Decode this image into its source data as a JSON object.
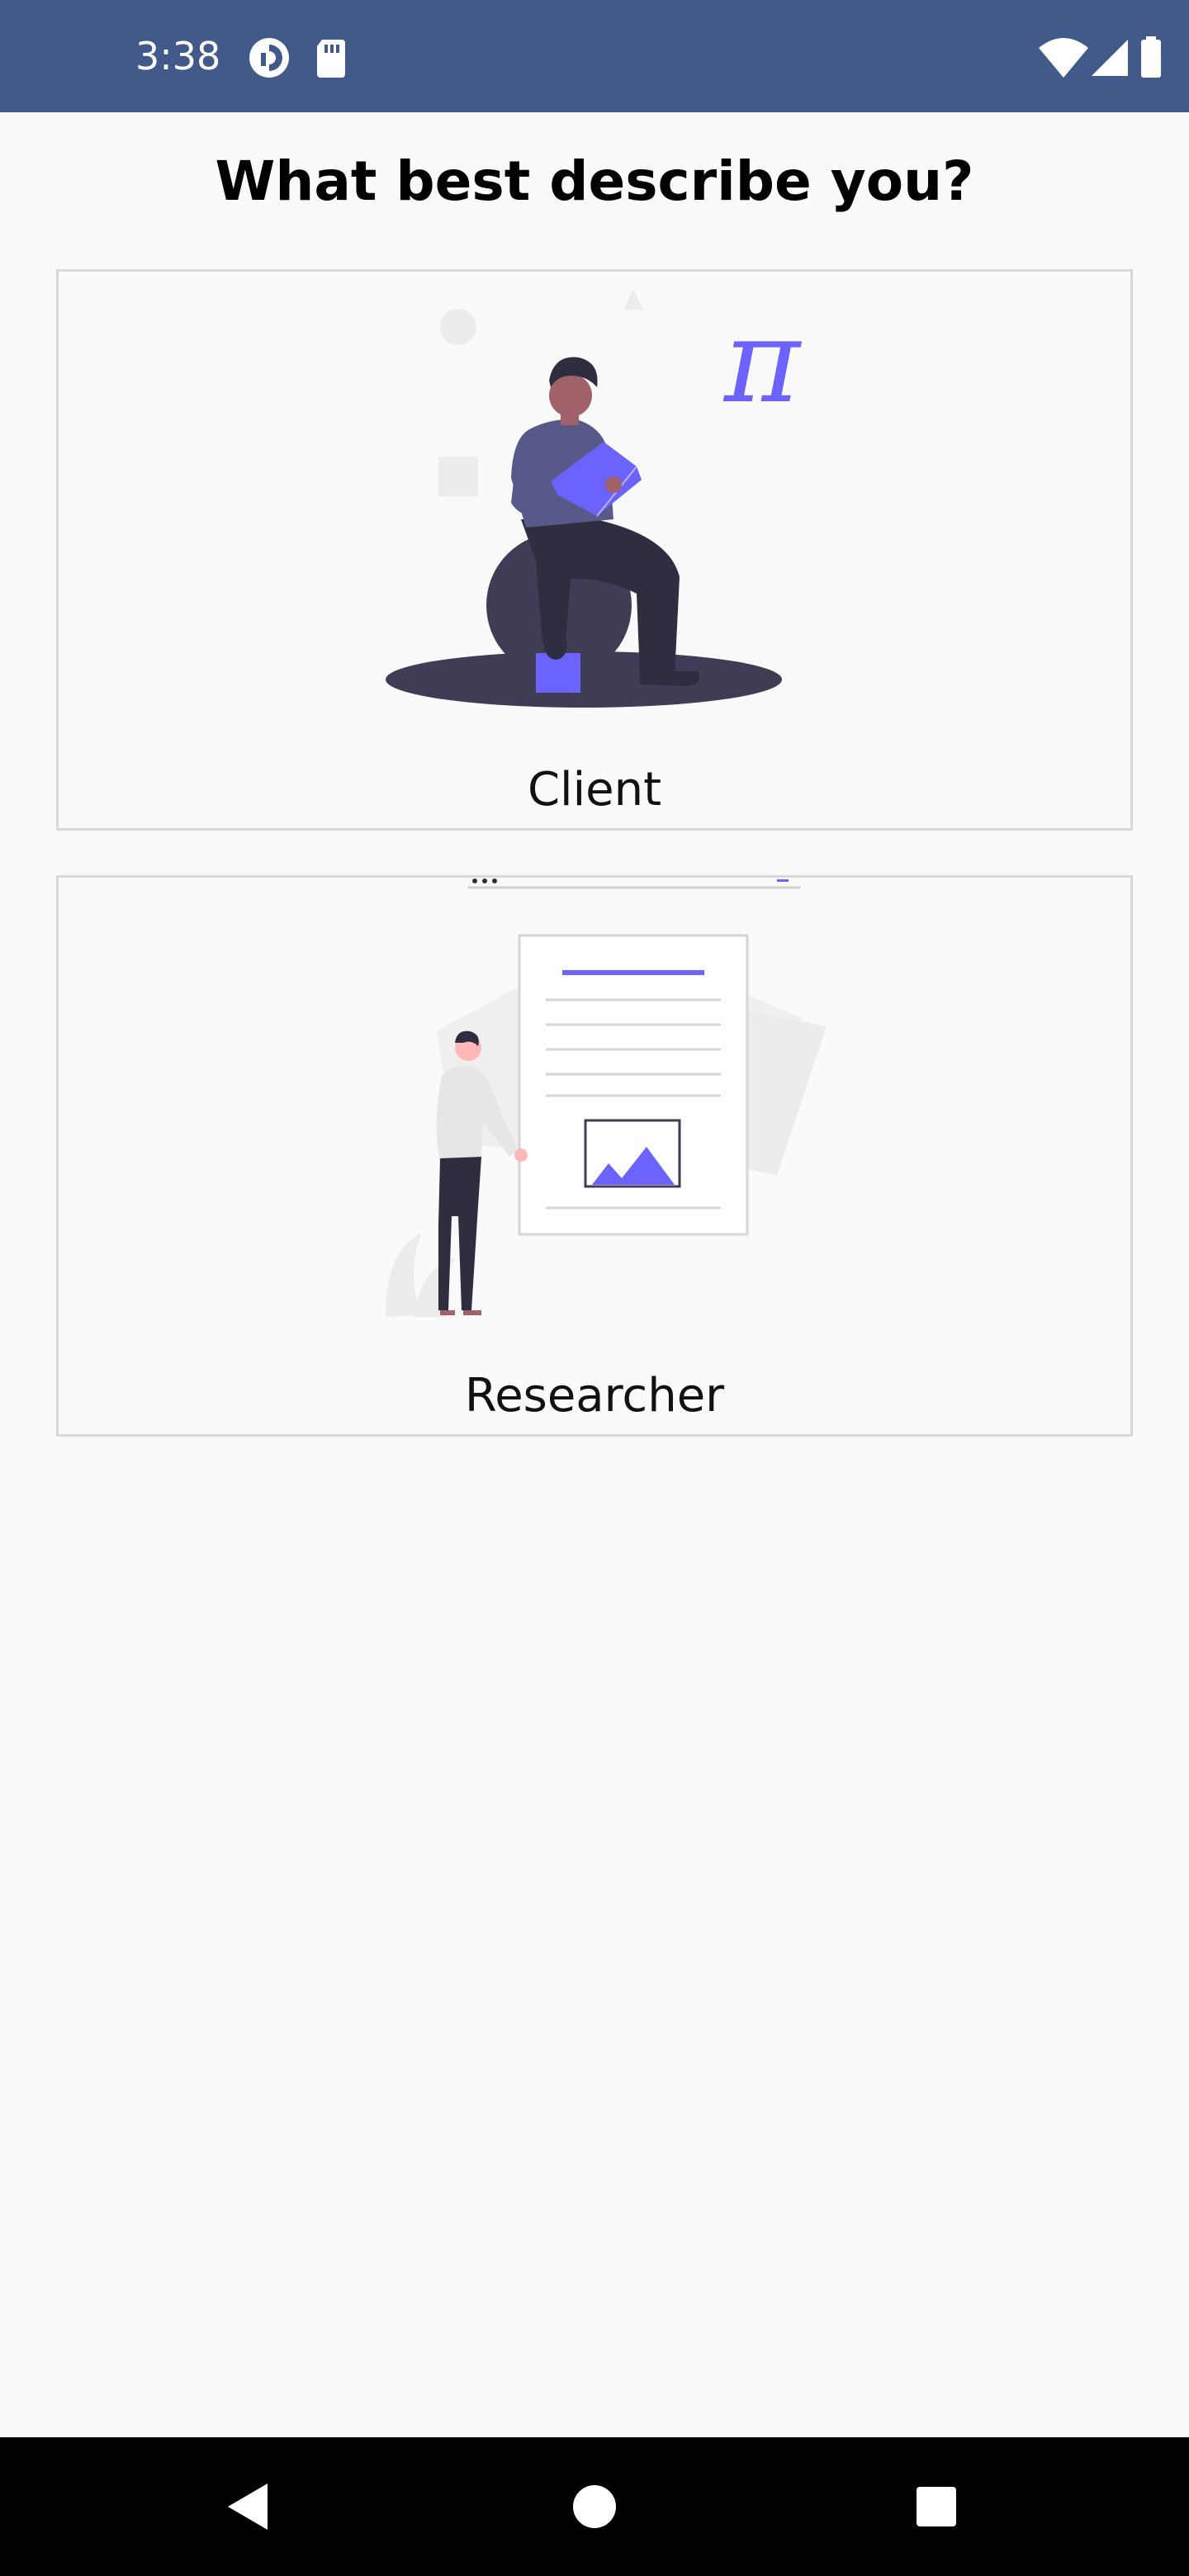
{
  "status_bar": {
    "time": "3:38",
    "background": "#425a8a",
    "icons": [
      "pocket-casts-icon",
      "sd-card-icon",
      "wifi-icon",
      "cell-signal-icon",
      "battery-icon"
    ]
  },
  "page": {
    "title": "What best describe you?"
  },
  "options": [
    {
      "label": "Client",
      "illustration": "person-reading-book-illustration"
    },
    {
      "label": "Researcher",
      "illustration": "person-presenting-document-illustration"
    }
  ],
  "colors": {
    "accent": "#6c63ff",
    "dark_figure": "#2f2e41",
    "card_border": "#d9d9d9",
    "background": "#fafafa"
  },
  "nav_bar": {
    "buttons": [
      "back-icon",
      "home-icon",
      "recents-icon"
    ]
  }
}
